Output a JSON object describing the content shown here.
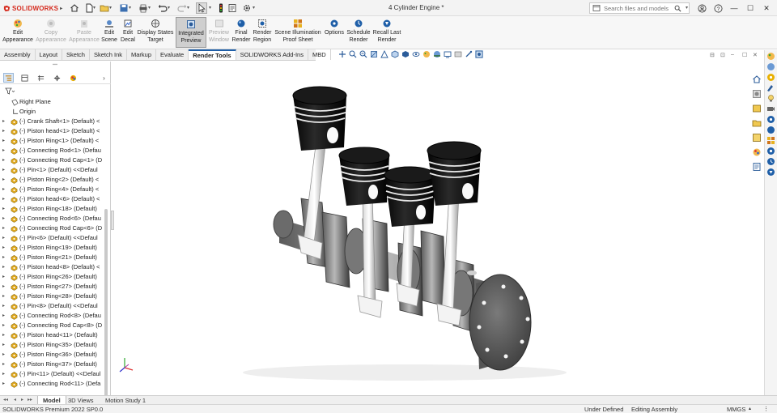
{
  "app": {
    "brand": "SOLIDWORKS",
    "document_title": "4 Cylinder Engine *",
    "search_placeholder": "Search files and models"
  },
  "window_controls": {
    "minimize": "—",
    "maximize": "☐",
    "close": "✕"
  },
  "command_manager": [
    {
      "lines": [
        "Edit",
        "Appearance"
      ],
      "enabled": true
    },
    {
      "lines": [
        "Copy",
        "Appearance"
      ],
      "enabled": false
    },
    {
      "lines": [
        "Paste",
        "Appearance"
      ],
      "enabled": false
    },
    {
      "lines": [
        "Edit",
        "Scene"
      ],
      "enabled": true
    },
    {
      "lines": [
        "Edit",
        "Decal"
      ],
      "enabled": true
    },
    {
      "lines": [
        "Display States",
        "Target"
      ],
      "enabled": true
    },
    {
      "lines": [
        "Integrated",
        "Preview"
      ],
      "enabled": true,
      "active": true
    },
    {
      "lines": [
        "Preview",
        "Window"
      ],
      "enabled": false
    },
    {
      "lines": [
        "Final",
        "Render"
      ],
      "enabled": true
    },
    {
      "lines": [
        "Render",
        "Region"
      ],
      "enabled": true
    },
    {
      "lines": [
        "Scene Illumination",
        "Proof Sheet"
      ],
      "enabled": true
    },
    {
      "lines": [
        "Options",
        ""
      ],
      "enabled": true
    },
    {
      "lines": [
        "Schedule",
        "Render"
      ],
      "enabled": true
    },
    {
      "lines": [
        "Recall Last",
        "Render"
      ],
      "enabled": true
    }
  ],
  "tabs": [
    "Assembly",
    "Layout",
    "Sketch",
    "Sketch Ink",
    "Markup",
    "Evaluate",
    "Render Tools",
    "SOLIDWORKS Add-Ins",
    "MBD"
  ],
  "active_tab": "Render Tools",
  "feature_tree": [
    {
      "label": "Right Plane",
      "kind": "plane"
    },
    {
      "label": "Origin",
      "kind": "origin"
    },
    {
      "label": "(-) Crank Shaft<1> (Default) <",
      "kind": "part"
    },
    {
      "label": "(-) Piston head<1> (Default) <",
      "kind": "part"
    },
    {
      "label": "(-) Piston Ring<1> (Default) <",
      "kind": "part"
    },
    {
      "label": "(-) Connecting Rod<1> (Defau",
      "kind": "part"
    },
    {
      "label": "(-) Connecting Rod Cap<1> (D",
      "kind": "part"
    },
    {
      "label": "(-) Pin<1> (Default) <<Defaul",
      "kind": "part"
    },
    {
      "label": "(-) Piston Ring<2> (Default) <",
      "kind": "part"
    },
    {
      "label": "(-) Piston Ring<4> (Default) <",
      "kind": "part"
    },
    {
      "label": "(-) Piston head<6> (Default) <",
      "kind": "part"
    },
    {
      "label": "(-) Piston Ring<18> (Default)",
      "kind": "part"
    },
    {
      "label": "(-) Connecting Rod<6> (Defau",
      "kind": "part"
    },
    {
      "label": "(-) Connecting Rod Cap<6> (D",
      "kind": "part"
    },
    {
      "label": "(-) Pin<6> (Default) <<Defaul",
      "kind": "part"
    },
    {
      "label": "(-) Piston Ring<19> (Default)",
      "kind": "part"
    },
    {
      "label": "(-) Piston Ring<21> (Default)",
      "kind": "part"
    },
    {
      "label": "(-) Piston head<8> (Default) <",
      "kind": "part"
    },
    {
      "label": "(-) Piston Ring<26> (Default)",
      "kind": "part"
    },
    {
      "label": "(-) Piston Ring<27> (Default)",
      "kind": "part"
    },
    {
      "label": "(-) Piston Ring<28> (Default)",
      "kind": "part"
    },
    {
      "label": "(-) Pin<8> (Default) <<Defaul",
      "kind": "part"
    },
    {
      "label": "(-) Connecting Rod<8> (Defau",
      "kind": "part"
    },
    {
      "label": "(-) Connecting Rod Cap<8> (D",
      "kind": "part"
    },
    {
      "label": "(-) Piston head<11> (Default)",
      "kind": "part"
    },
    {
      "label": "(-) Piston Ring<35> (Default)",
      "kind": "part"
    },
    {
      "label": "(-) Piston Ring<36> (Default)",
      "kind": "part"
    },
    {
      "label": "(-) Piston Ring<37> (Default)",
      "kind": "part"
    },
    {
      "label": "(-) Pin<11> (Default) <<Defaul",
      "kind": "part"
    },
    {
      "label": "(-) Connecting Rod<11> (Defa",
      "kind": "part"
    }
  ],
  "bottom_tabs": [
    "Model",
    "3D Views",
    "Motion Study 1"
  ],
  "active_bottom_tab": "Model",
  "status": {
    "version": "SOLIDWORKS Premium 2022 SP0.0",
    "definition": "Under Defined",
    "mode": "Editing Assembly",
    "units": "MMGS"
  },
  "colors": {
    "brand_red": "#d52b1e",
    "active_tab_accent": "#1f5fa8",
    "part_icon": "#e0a81c"
  }
}
